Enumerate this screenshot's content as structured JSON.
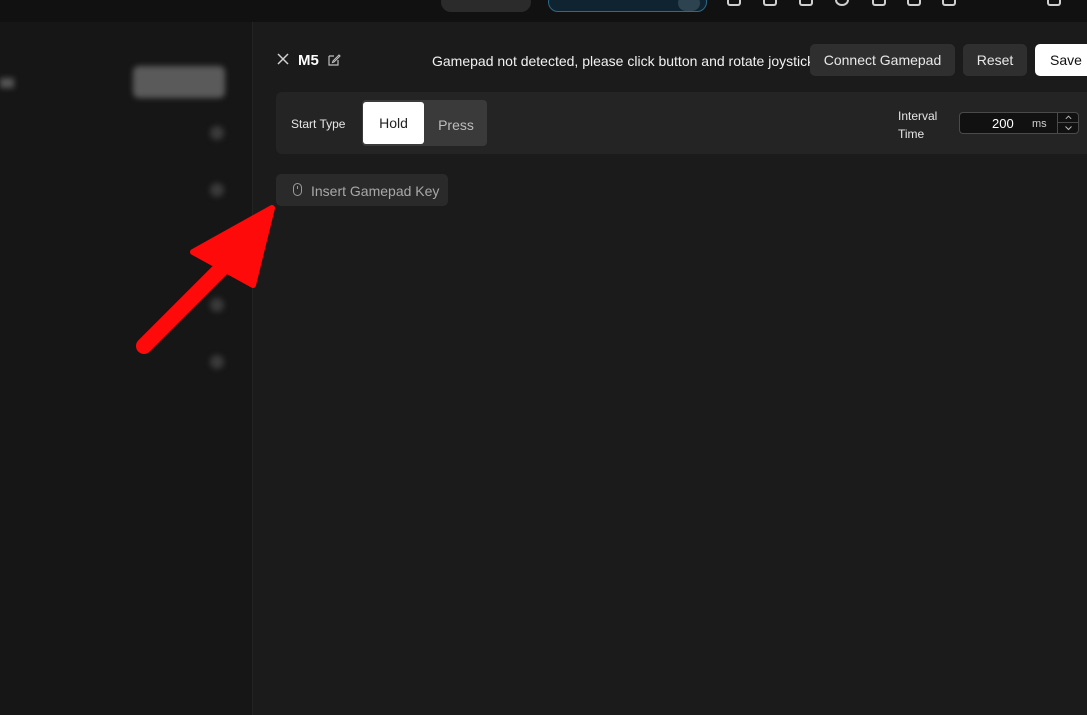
{
  "panel": {
    "title": "M5",
    "notice": "Gamepad not detected, please click button and rotate joystick",
    "buttons": {
      "connect": "Connect Gamepad",
      "reset": "Reset",
      "save": "Save"
    }
  },
  "config": {
    "start_type_label": "Start Type",
    "start_type_options": [
      "Hold",
      "Press"
    ],
    "start_type_selected": "Hold",
    "interval_label": "Interval Time",
    "interval_value": "200",
    "interval_unit": "ms"
  },
  "actions": {
    "insert_label": "Insert Gamepad Key"
  },
  "colors": {
    "background": "#181818",
    "panel": "#1b1b1b",
    "annotation_arrow": "#ff0a0a"
  },
  "icons": {
    "close": "close-icon",
    "edit": "edit-icon",
    "mouse": "mouse-icon",
    "stepper_up": "chevron-up-icon",
    "stepper_down": "chevron-down-icon"
  }
}
